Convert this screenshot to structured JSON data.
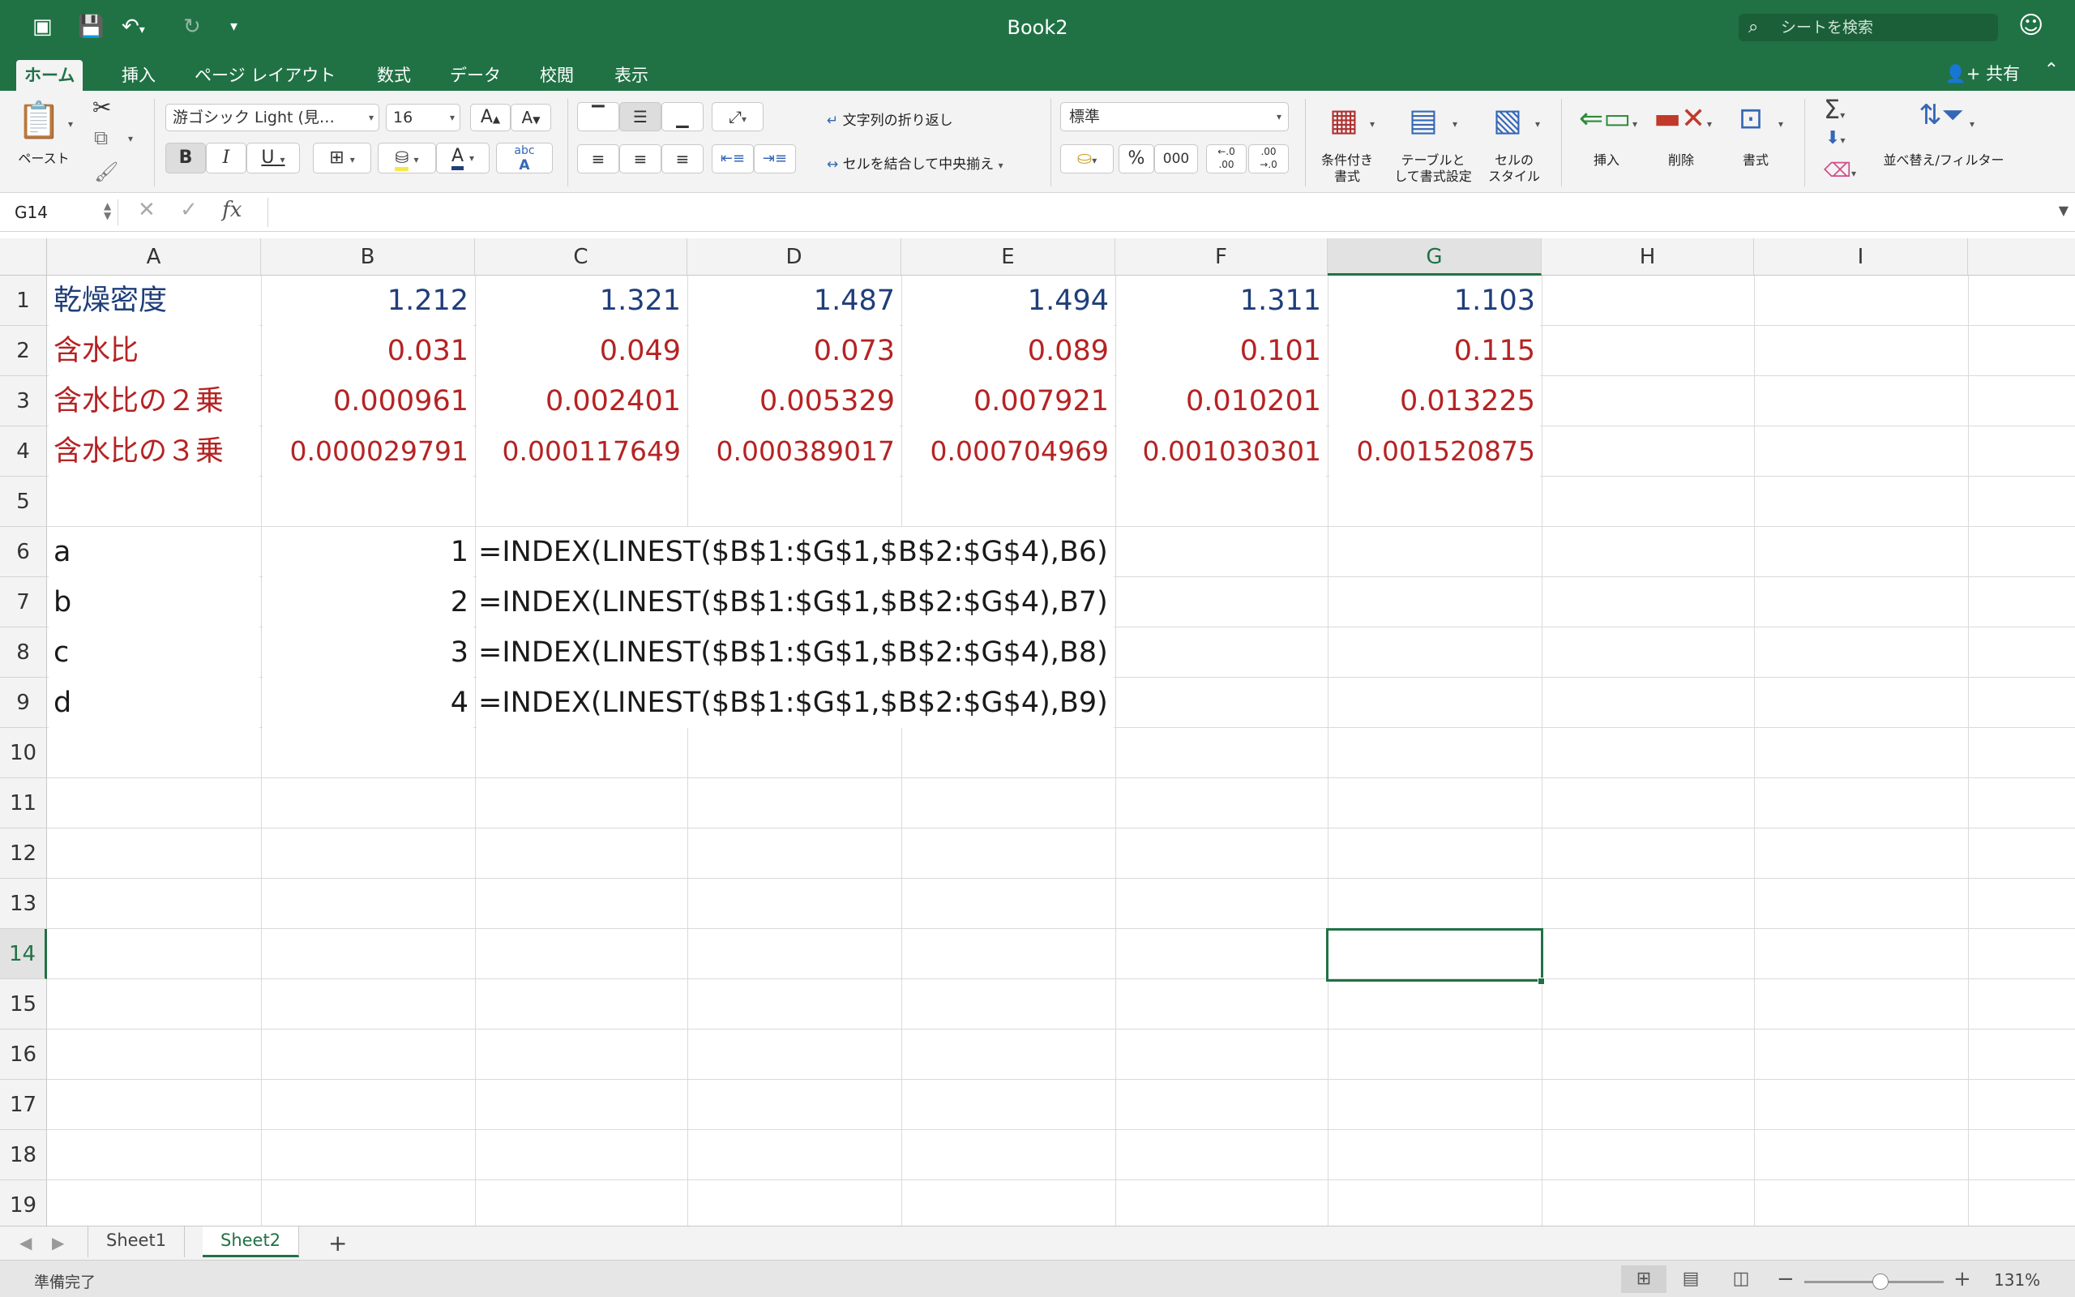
{
  "app": {
    "title": "Book2",
    "search_placeholder": "シートを検索",
    "share_label": "共有"
  },
  "tabs": [
    "ホーム",
    "挿入",
    "ページ レイアウト",
    "数式",
    "データ",
    "校閲",
    "表示"
  ],
  "ribbon": {
    "paste_label": "ペースト",
    "font_name": "游ゴシック Light (見…",
    "font_size": "16",
    "bold": "B",
    "italic": "I",
    "underline": "U",
    "font_color_letter": "A",
    "grow_font": "A",
    "shrink_font": "A",
    "phonetic": "abc",
    "wrap_text": "文字列の折り返し",
    "merge_center": "セルを結合して中央揃え",
    "number_format": "標準",
    "percent": "%",
    "thousands": "000",
    "inc_decimal_top": "←.0",
    "inc_decimal_bottom": ".00",
    "dec_decimal_top": ".00",
    "dec_decimal_bottom": "→.0",
    "conditional_format": [
      "条件付き",
      "書式"
    ],
    "format_as_table": [
      "テーブルと",
      "して書式設定"
    ],
    "cell_styles": [
      "セルの",
      "スタイル"
    ],
    "insert": "挿入",
    "delete": "削除",
    "format": "書式",
    "sort_filter": "並べ替え/フィルター",
    "autosum": "Σ"
  },
  "formula_bar": {
    "name_box": "G14",
    "fx": "fx",
    "formula": ""
  },
  "grid": {
    "columns": [
      "A",
      "B",
      "C",
      "D",
      "E",
      "F",
      "G",
      "H",
      "I"
    ],
    "selected_column": "G",
    "rows": [
      "1",
      "2",
      "3",
      "4",
      "5",
      "6",
      "7",
      "8",
      "9",
      "10",
      "11",
      "12",
      "13",
      "14",
      "15",
      "16",
      "17",
      "18",
      "19"
    ],
    "selected_row": "14",
    "row1": {
      "label": "乾燥密度",
      "values": [
        "1.212",
        "1.321",
        "1.487",
        "1.494",
        "1.311",
        "1.103"
      ]
    },
    "row2": {
      "label": "含水比",
      "values": [
        "0.031",
        "0.049",
        "0.073",
        "0.089",
        "0.101",
        "0.115"
      ]
    },
    "row3": {
      "label": "含水比の２乗",
      "values": [
        "0.000961",
        "0.002401",
        "0.005329",
        "0.007921",
        "0.010201",
        "0.013225"
      ]
    },
    "row4": {
      "label": "含水比の３乗",
      "values": [
        "0.000029791",
        "0.000117649",
        "0.000389017",
        "0.000704969",
        "0.001030301",
        "0.001520875"
      ]
    },
    "coef_rows": [
      {
        "label": "a",
        "index": "1",
        "formula": "=INDEX(LINEST($B$1:$G$1,$B$2:$G$4),B6)"
      },
      {
        "label": "b",
        "index": "2",
        "formula": "=INDEX(LINEST($B$1:$G$1,$B$2:$G$4),B7)"
      },
      {
        "label": "c",
        "index": "3",
        "formula": "=INDEX(LINEST($B$1:$G$1,$B$2:$G$4),B8)"
      },
      {
        "label": "d",
        "index": "4",
        "formula": "=INDEX(LINEST($B$1:$G$1,$B$2:$G$4),B9)"
      }
    ]
  },
  "sheets": [
    {
      "name": "Sheet1",
      "active": false
    },
    {
      "name": "Sheet2",
      "active": true
    }
  ],
  "status": {
    "text": "準備完了",
    "zoom": "131%"
  }
}
